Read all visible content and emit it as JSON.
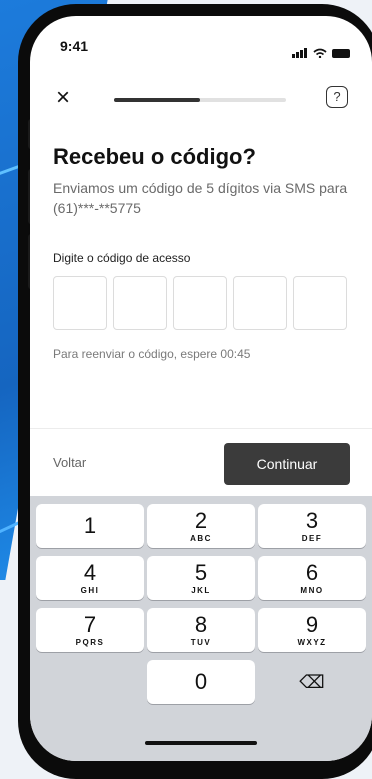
{
  "status": {
    "time": "9:41"
  },
  "progress": {
    "fraction": 0.5
  },
  "help_icon": "?",
  "close_icon": "×",
  "title": "Recebeu o código?",
  "subtitle": "Enviamos um código de 5 dígitos via SMS para (61)***-**5775",
  "code_label": "Digite o código de acesso",
  "code_values": [
    "",
    "",
    "",
    "",
    ""
  ],
  "resend": "Para reenviar o código, espere 00:45",
  "actions": {
    "back": "Voltar",
    "continue": "Continuar"
  },
  "keys": {
    "k1": {
      "num": "1",
      "letters": ""
    },
    "k2": {
      "num": "2",
      "letters": "ABC"
    },
    "k3": {
      "num": "3",
      "letters": "DEF"
    },
    "k4": {
      "num": "4",
      "letters": "GHI"
    },
    "k5": {
      "num": "5",
      "letters": "JKL"
    },
    "k6": {
      "num": "6",
      "letters": "MNO"
    },
    "k7": {
      "num": "7",
      "letters": "PQRS"
    },
    "k8": {
      "num": "8",
      "letters": "TUV"
    },
    "k9": {
      "num": "9",
      "letters": "WXYZ"
    },
    "k0": {
      "num": "0",
      "letters": ""
    },
    "backspace": "⌫"
  },
  "colors": {
    "accent_blue": "#1565c0",
    "button_dark": "#3b3b3b"
  }
}
